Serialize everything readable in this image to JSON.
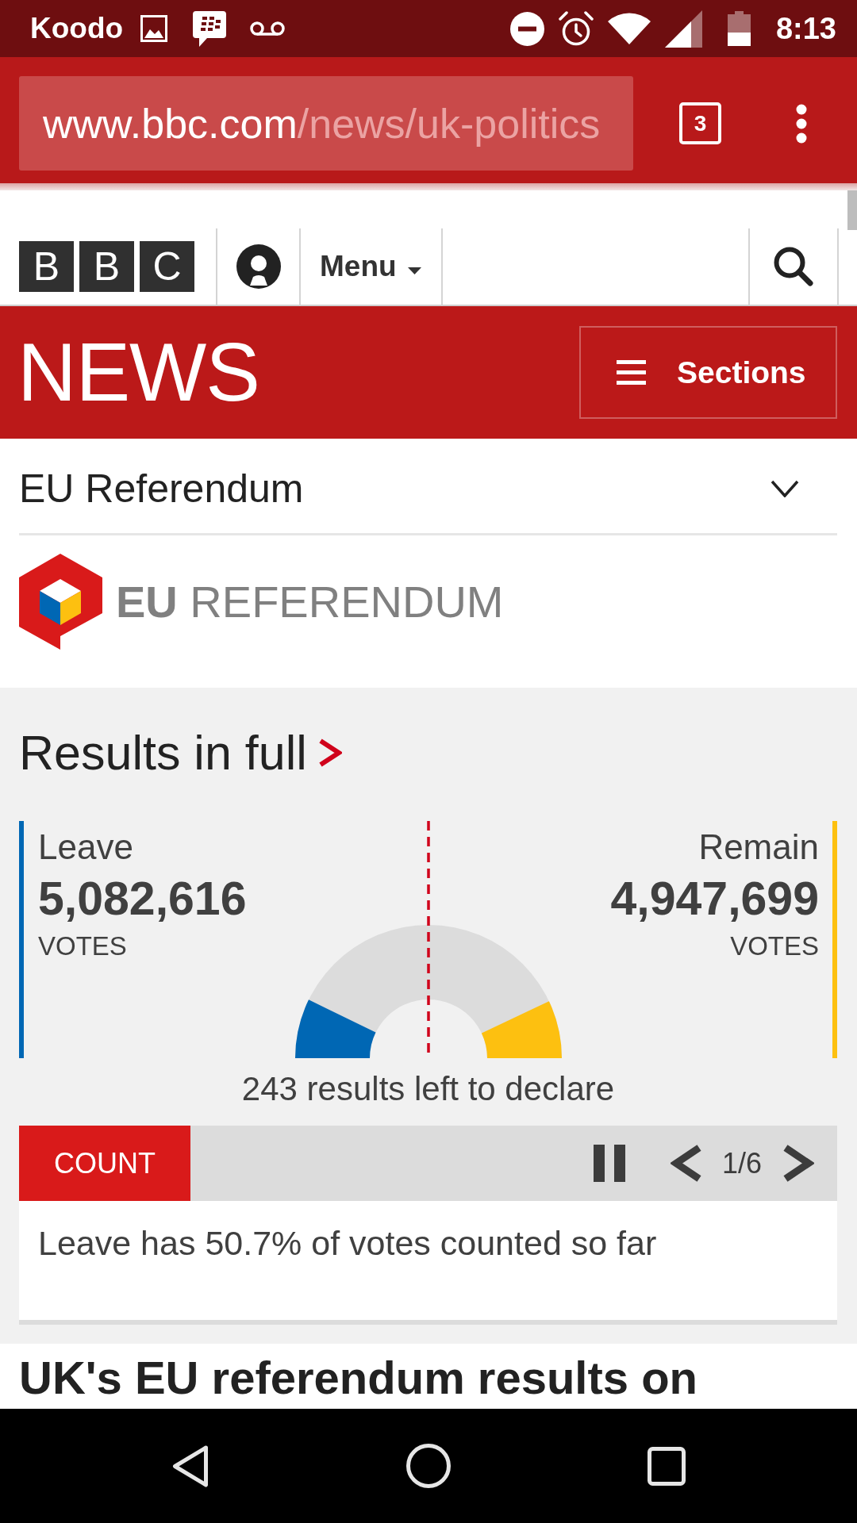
{
  "status_bar": {
    "carrier": "Koodo",
    "time": "8:13"
  },
  "browser_bar": {
    "url_host": "www.bbc.com",
    "url_path": "/news/uk-politics",
    "tab_count": "3"
  },
  "site_header": {
    "logo_letters": [
      "B",
      "B",
      "C"
    ],
    "menu_label": "Menu"
  },
  "news_banner": {
    "title": "NEWS",
    "sections_label": "Sections"
  },
  "section_nav": {
    "title": "EU Referendum",
    "expanded": false
  },
  "referendum_logo": {
    "text": "**EU** REFERENDUM"
  },
  "results": {
    "heading": "Results in full",
    "sides": [
      {
        "name": "Leave",
        "votes": "5,082,616",
        "unit": "VOTES",
        "color": "#0067b4"
      },
      {
        "name": "Remain",
        "votes": "4,947,699",
        "unit": "VOTES",
        "color": "#fdc010"
      }
    ],
    "remaining": "243 results left to declare"
  },
  "ticker": {
    "tag": "COUNT",
    "playing": true,
    "page": "1/6",
    "message": "Leave has 50.7% of votes counted so far"
  },
  "article": {
    "headline": "UK's EU referendum results on"
  }
}
